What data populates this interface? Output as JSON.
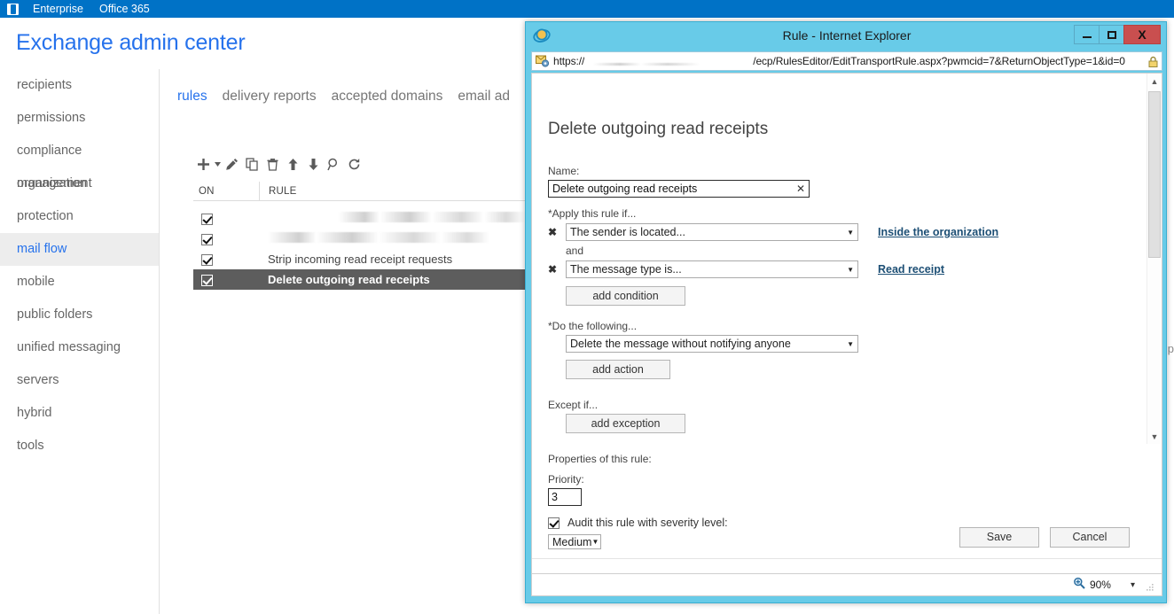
{
  "suite_bar": {
    "logo": "office-logo",
    "links": [
      "Enterprise",
      "Office 365"
    ]
  },
  "eac": {
    "title": "Exchange admin center",
    "nav_items": [
      "recipients",
      "permissions",
      "compliance management",
      "organization",
      "protection",
      "mail flow",
      "mobile",
      "public folders",
      "unified messaging",
      "servers",
      "hybrid",
      "tools"
    ],
    "selected_nav": "mail flow",
    "tabs": [
      "rules",
      "delivery reports",
      "accepted domains",
      "email ad"
    ],
    "active_tab": "rules",
    "toolbar_icons": [
      "add-icon",
      "add-dropdown-caret",
      "edit-pencil-icon",
      "copy-icon",
      "delete-trash-icon",
      "move-up-arrow-icon",
      "move-down-arrow-icon",
      "search-icon",
      "refresh-icon"
    ],
    "table": {
      "columns": [
        "ON",
        "RULE"
      ],
      "rows": [
        {
          "on": true,
          "rule": "",
          "redacted": true
        },
        {
          "on": true,
          "rule": "",
          "redacted": true
        },
        {
          "on": true,
          "rule": "Strip incoming read receipt requests",
          "redacted": false
        },
        {
          "on": true,
          "rule": "Delete outgoing read receipts",
          "redacted": false
        }
      ],
      "selected_row_index": 3
    },
    "right_partial_label": "ecip"
  },
  "ie_window": {
    "title": "Rule - Internet Explorer",
    "icon": "internet-explorer-icon",
    "window_buttons": {
      "minimize": "–",
      "maximize": "□",
      "close": "X"
    },
    "address": {
      "favicon": "page-with-gear-icon",
      "url_prefix": "https://",
      "url_suffix": "/ecp/RulesEditor/EditTransportRule.aspx?pwmcid=7&ReturnObjectType=1&id=0",
      "lock": "lock-icon"
    },
    "status_bar": {
      "zoom_icon": "zoom-magnifier-icon",
      "zoom_level": "90%",
      "caret": "▾"
    }
  },
  "rule_form": {
    "heading": "Delete outgoing read receipts",
    "name_label": "Name:",
    "name_value": "Delete outgoing read receipts",
    "name_clear": "✕",
    "apply_label": "*Apply this rule if...",
    "conditions": [
      {
        "remove": "✖",
        "value": "The sender is located...",
        "link": "Inside the organization"
      },
      {
        "remove": "✖",
        "value": "The message type is...",
        "link": "Read receipt"
      }
    ],
    "and_text": "and",
    "add_condition_label": "add condition",
    "do_label": "*Do the following...",
    "action_value": "Delete the message without notifying anyone",
    "add_action_label": "add action",
    "except_label": "Except if...",
    "add_exception_label": "add exception",
    "properties_label": "Properties of this rule:",
    "priority_label": "Priority:",
    "priority_value": "3",
    "audit_label": "Audit this rule with severity level:",
    "audit_checked": true,
    "severity_value": "Medium",
    "save_label": "Save",
    "cancel_label": "Cancel"
  },
  "colors": {
    "suite_bar": "#0072c6",
    "accent_blue": "#2672ec",
    "ie_chrome": "#68cbe8",
    "close_red": "#c94f4f",
    "selected_row": "#5d5d5d",
    "link": "#1d4f75"
  }
}
